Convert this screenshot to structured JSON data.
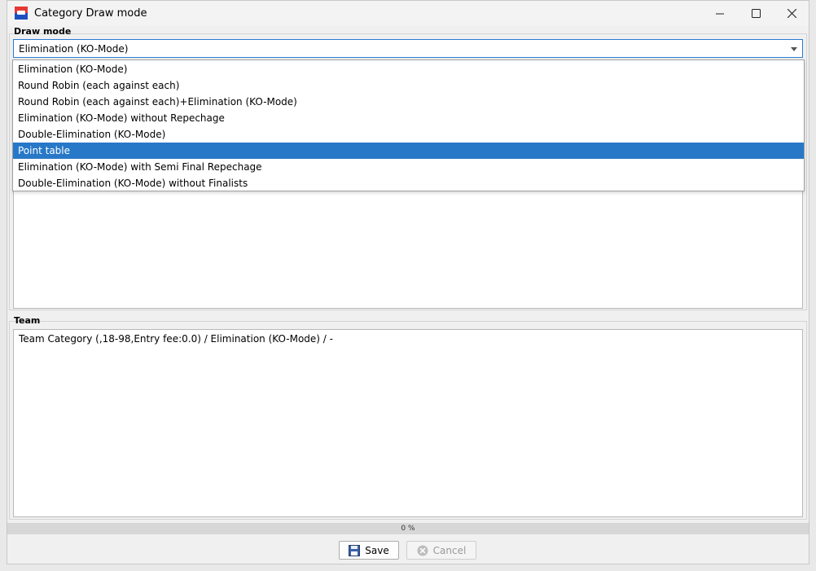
{
  "window": {
    "title": "Category Draw mode",
    "icon": "app-flag-icon",
    "controls": [
      "minimize-icon",
      "maximize-icon",
      "close-icon"
    ]
  },
  "draw_mode": {
    "label": "Draw mode",
    "selected": "Elimination (KO-Mode)",
    "options": [
      "Elimination (KO-Mode)",
      "Round Robin (each against each)",
      "Round Robin (each against each)+Elimination (KO-Mode)",
      "Elimination (KO-Mode) without Repechage",
      "Double-Elimination (KO-Mode)",
      "Point table",
      "Elimination (KO-Mode) with Semi Final Repechage",
      "Double-Elimination (KO-Mode) without Finalists"
    ],
    "highlighted_index": 5
  },
  "team": {
    "label": "Team",
    "text": "Team Category (,18-98,Entry fee:0.0) / Elimination (KO-Mode) / -"
  },
  "progress": {
    "text": "0 %",
    "value": 0
  },
  "buttons": {
    "save": "Save",
    "cancel": "Cancel"
  },
  "colors": {
    "accent": "#2878c8",
    "focus_border": "#2b7bd3"
  }
}
